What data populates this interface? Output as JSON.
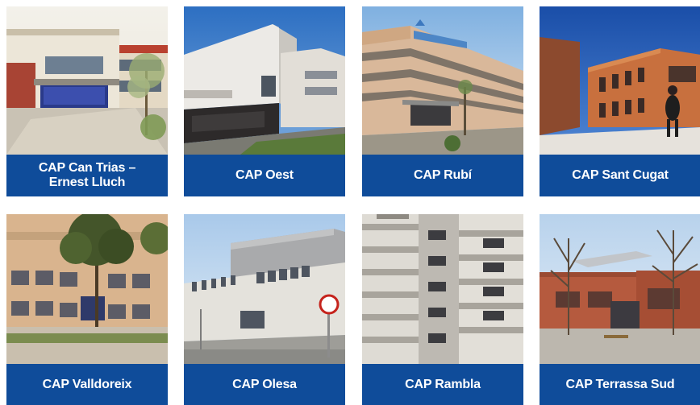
{
  "theme": {
    "label_bg": "#0f4c9a",
    "label_text": "#ffffff"
  },
  "cards": [
    {
      "label": "CAP Can Trias –\nErnest Lluch"
    },
    {
      "label": "CAP Oest"
    },
    {
      "label": "CAP Rubí"
    },
    {
      "label": "CAP Sant Cugat"
    },
    {
      "label": "CAP Valldoreix"
    },
    {
      "label": "CAP Olesa"
    },
    {
      "label": "CAP Rambla"
    },
    {
      "label": "CAP Terrassa Sud"
    }
  ]
}
